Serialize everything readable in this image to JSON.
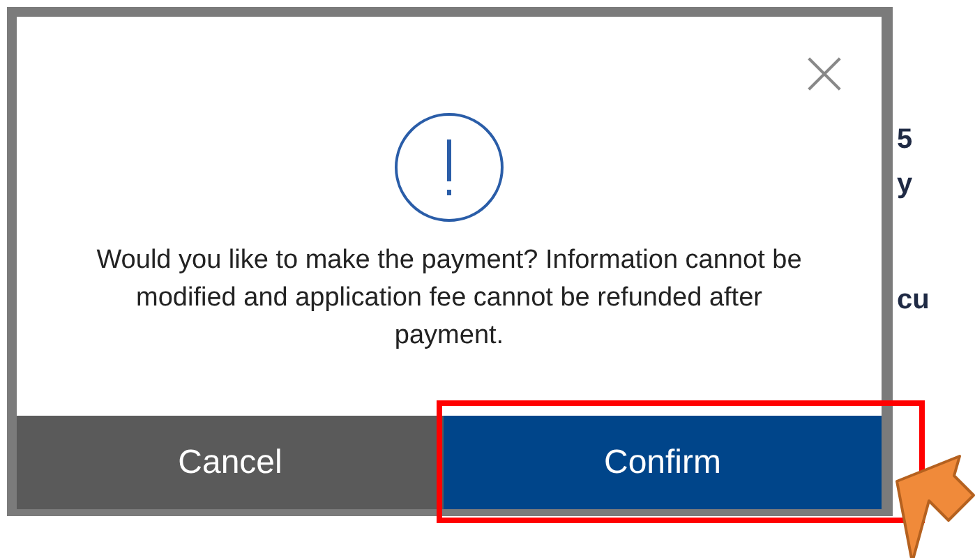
{
  "background_page": {
    "fragments": [
      "5",
      "y",
      "cu"
    ]
  },
  "dialog": {
    "message": "Would you like to make the payment? Information cannot be modified and application fee cannot be refunded after payment.",
    "buttons": [
      {
        "label": "Cancel",
        "kind": "secondary",
        "highlighted": false
      },
      {
        "label": "Confirm",
        "kind": "primary",
        "highlighted": true
      }
    ]
  }
}
